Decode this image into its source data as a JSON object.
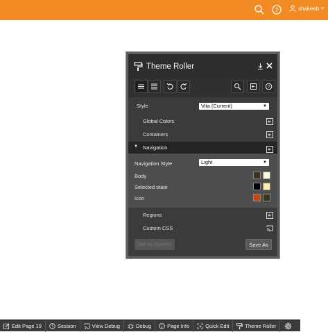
{
  "topbar": {
    "color": "#f28b24",
    "icons": [
      "search-icon",
      "help-icon",
      "user-icon"
    ],
    "username": "shakeeb",
    "menu_caret": "▾"
  },
  "theme_roller": {
    "title": "Theme Roller",
    "toolbar": {
      "icons": [
        "menu-icon",
        "list-icon",
        "undo-icon",
        "redo-icon",
        "search-icon",
        "export-icon",
        "help-icon"
      ]
    },
    "style": {
      "label": "Style",
      "value": "Vita (Current)"
    },
    "groups": {
      "global_colors": "Global Colors",
      "containers": "Containers",
      "navigation": "Navigation",
      "regions": "Regions",
      "custom_css": "Custom CSS"
    },
    "navigation": {
      "style_label": "Navigation Style",
      "style_value": "Light",
      "body_label": "Body",
      "selected_label": "Selected state",
      "icon_label": "Icon",
      "swatches": {
        "body": [
          "#3a3418",
          "#fff8df"
        ],
        "selected": [
          "#000000",
          "#fdf1a8"
        ],
        "icon": [
          "#c4470e",
          "#3a3418"
        ]
      }
    },
    "buttons": {
      "set_current": "Set as Current",
      "save_as": "Save As"
    }
  },
  "devbar": {
    "items": [
      {
        "label": "Edit Page 19",
        "icon": "edit-icon"
      },
      {
        "label": "Session",
        "icon": "clock-icon"
      },
      {
        "label": "View Debug",
        "icon": "cast-icon"
      },
      {
        "label": "Debug",
        "icon": "bug-icon"
      },
      {
        "label": "Page Info",
        "icon": "info-icon"
      },
      {
        "label": "Quick Edit",
        "icon": "quick-edit-icon"
      },
      {
        "label": "Theme Roller",
        "icon": "paint-roller-icon"
      }
    ],
    "settings_icon": "gear-icon"
  }
}
